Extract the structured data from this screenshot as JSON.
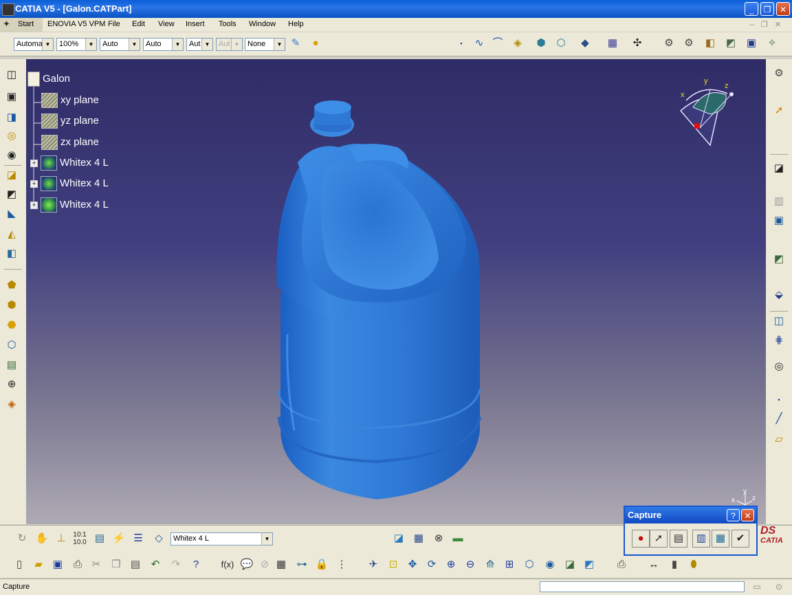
{
  "window": {
    "title": "CATIA V5 - [Galon.CATPart]",
    "minimize": "_",
    "restore": "❐",
    "close": "✕"
  },
  "menu": [
    "Start",
    "ENOVIA V5 VPM",
    "File",
    "Edit",
    "View",
    "Insert",
    "Tools",
    "Window",
    "Help"
  ],
  "toolbar_combos": {
    "c1": "Automa",
    "c2": "100%",
    "c3": "Auto",
    "c4": "Auto",
    "c5": "Aut",
    "c6": "Aut",
    "c7": "None"
  },
  "tree": {
    "root": "Galon",
    "planes": [
      "xy plane",
      "yz plane",
      "zx plane"
    ],
    "bodies": [
      "Whitex 4 L",
      "Whitex 4 L",
      "Whitex 4 L"
    ]
  },
  "compass": {
    "x": "x",
    "y": "y",
    "z": "z"
  },
  "axis_small": {
    "x": "x",
    "y": "y",
    "z": "z"
  },
  "bottom_combo": "Whitex 4 L",
  "bottom_formula_label": "f(x)",
  "capture": {
    "title": "Capture",
    "help": "?",
    "close": "✕"
  },
  "catia_logo": "CATIA",
  "status": {
    "text": "Capture"
  },
  "colors": {
    "bottle": "#2f79d6",
    "viewport_top": "#2f2c66",
    "viewport_bottom": "#aeaab4"
  }
}
